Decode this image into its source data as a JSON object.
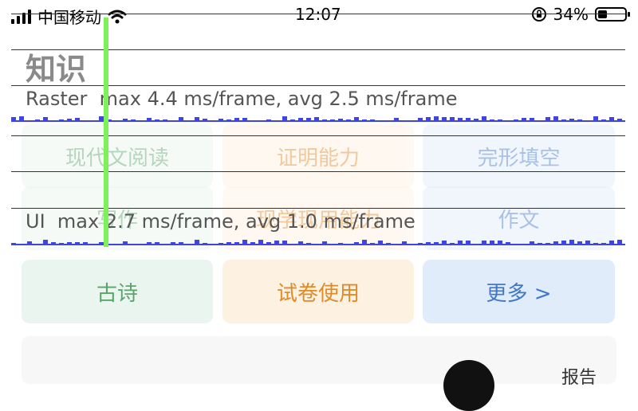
{
  "status_bar": {
    "carrier": "中国移动",
    "time": "12:07",
    "battery_percent": "34%",
    "battery_level": 0.34,
    "icons": [
      "signal-icon",
      "wifi-icon",
      "rotation-lock-icon",
      "battery-icon"
    ]
  },
  "section": {
    "title": "知识"
  },
  "tiles": [
    {
      "label": "现代文阅读",
      "color": "green",
      "faded": true
    },
    {
      "label": "证明能力",
      "color": "orange",
      "faded": true
    },
    {
      "label": "完形填空",
      "color": "blue",
      "faded": true
    },
    {
      "label": "写作",
      "color": "green",
      "faded": true
    },
    {
      "label": "现学现用能力",
      "color": "orange",
      "faded": true
    },
    {
      "label": "作文",
      "color": "blue",
      "faded": true
    },
    {
      "label": "古诗",
      "color": "green",
      "faded": false
    },
    {
      "label": "试卷使用",
      "color": "orange",
      "faded": false
    },
    {
      "label": "更多 >",
      "color": "blue",
      "faded": false
    }
  ],
  "perf_overlay": {
    "raster": "Raster  max 4.4 ms/frame, avg 2.5 ms/frame",
    "ui": "UI  max 2.7 ms/frame, avg 1.0 ms/frame",
    "bar_color": "#3e45e0",
    "marker_color": "#7ef05a"
  },
  "bottom_card": {
    "label": "报告"
  },
  "colors": {
    "green_tile_bg": "#e9f5ee",
    "green_tile_text": "#5aa56a",
    "orange_tile_bg": "#fdf1e2",
    "orange_tile_text": "#e08a28",
    "blue_tile_bg": "#e1ecfb",
    "blue_tile_text": "#3f78c8"
  }
}
